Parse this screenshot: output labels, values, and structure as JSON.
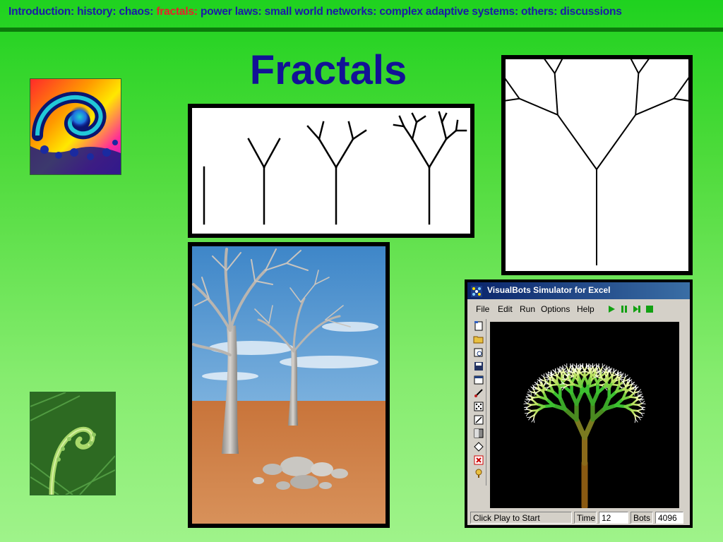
{
  "nav": {
    "items": [
      {
        "label": "Introduction"
      },
      {
        "label": "history"
      },
      {
        "label": "chaos"
      },
      {
        "label": "fractals",
        "active": true
      },
      {
        "label": "power laws"
      },
      {
        "label": "small world networks"
      },
      {
        "label": "complex adaptive systems"
      },
      {
        "label": "others"
      },
      {
        "label": "discussions"
      }
    ],
    "separator": ":",
    "active_color": "#e8202a",
    "color": "#1a1aa8"
  },
  "slide": {
    "title": "Fractals"
  },
  "images": {
    "fractal_spiral": "julia-set-spiral",
    "fern": "fern-fiddlehead",
    "tree_steps": "branching-tree-iterations",
    "binary_tree": "binary-fractal-tree",
    "desert_trees": "3d-fractal-trees-desert"
  },
  "visualbots": {
    "window_title": "VisualBots Simulator for Excel",
    "menu": [
      "File",
      "Edit",
      "Run",
      "Options",
      "Help"
    ],
    "status": {
      "message": "Click Play to Start",
      "time_label": "Time",
      "time_value": "12",
      "bots_label": "Bots",
      "bots_value": "4096"
    }
  }
}
